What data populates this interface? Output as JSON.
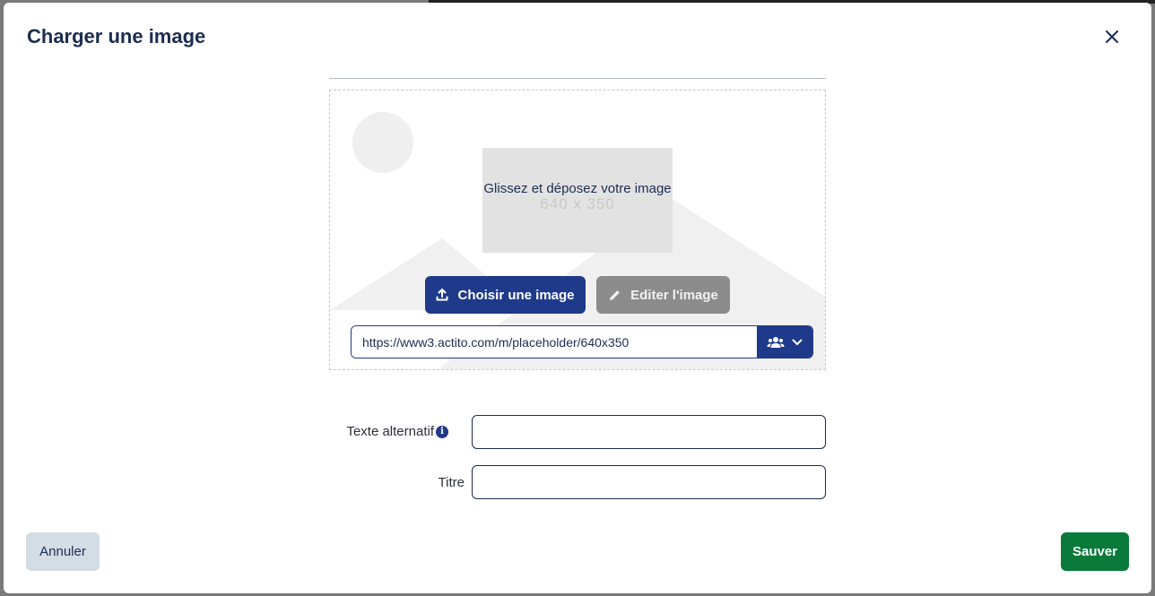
{
  "modal": {
    "title": "Charger une image",
    "close_icon": "close-icon"
  },
  "dropzone": {
    "prompt": "Glissez et déposez votre image",
    "placeholder_size": "640 x 350",
    "choose_button": "Choisir une image",
    "choose_icon": "upload-icon",
    "edit_button": "Editer l'image",
    "edit_icon": "pencil-icon",
    "url_value": "https://www3.actito.com/m/placeholder/640x350",
    "source_icon": "users-icon",
    "dropdown_icon": "chevron-down-icon"
  },
  "form": {
    "alt_label": "Texte alternatif",
    "alt_info_icon": "info-icon",
    "alt_value": "",
    "title_label": "Titre",
    "title_value": ""
  },
  "footer": {
    "cancel_label": "Annuler",
    "save_label": "Sauver"
  },
  "colors": {
    "primary": "#1f3a8a",
    "title_text": "#1c2d50",
    "save_green": "#0a7a3a",
    "cancel_bg": "#d3dde6",
    "edit_disabled": "#8c8c8c"
  }
}
